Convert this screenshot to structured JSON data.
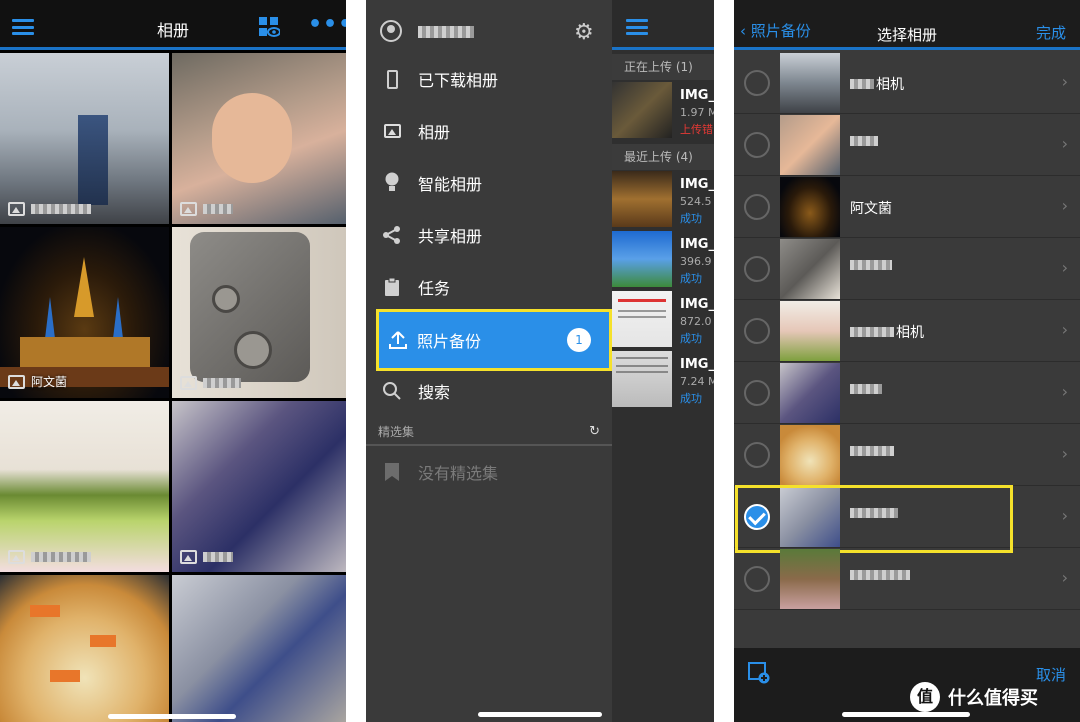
{
  "panel1": {
    "title": "相册",
    "tiles": [
      {
        "label": "",
        "label_visible": true
      },
      {
        "label": "",
        "label_visible": true
      },
      {
        "label": "阿文菌",
        "label_visible": true
      },
      {
        "label": "",
        "label_visible": true
      },
      {
        "label": "",
        "label_visible": true
      },
      {
        "label": "",
        "label_visible": true
      },
      {
        "label": "",
        "label_visible": false
      },
      {
        "label": "",
        "label_visible": false
      }
    ]
  },
  "panel2": {
    "menu": [
      {
        "label": "已下载相册",
        "icon": "phone-icon"
      },
      {
        "label": "相册",
        "icon": "image-icon"
      },
      {
        "label": "智能相册",
        "icon": "bulb-icon"
      },
      {
        "label": "共享相册",
        "icon": "share-icon"
      },
      {
        "label": "任务",
        "icon": "clipboard-icon"
      },
      {
        "label": "照片备份",
        "icon": "upload-icon",
        "badge": "1"
      },
      {
        "label": "搜索",
        "icon": "search-icon"
      }
    ],
    "section_label": "精选集",
    "empty_label": "没有精选集",
    "uploading_label": "正在上传 (1)",
    "recent_label": "最近上传 (4)",
    "uploads": [
      {
        "name": "IMG_",
        "size": "1.97 M",
        "status": "上传错",
        "error": true
      },
      {
        "name": "IMG_",
        "size": "524.5",
        "status": "成功",
        "error": false
      },
      {
        "name": "IMG_",
        "size": "396.9",
        "status": "成功",
        "error": false
      },
      {
        "name": "IMG_",
        "size": "872.0",
        "status": "成功",
        "error": false
      },
      {
        "name": "IMG_",
        "size": "7.24 M",
        "status": "成功",
        "error": false
      }
    ]
  },
  "panel3": {
    "back_label": "照片备份",
    "title": "选择相册",
    "done_label": "完成",
    "cancel_label": "取消",
    "albums": [
      {
        "name": "相机",
        "checked": false
      },
      {
        "name": "",
        "checked": false
      },
      {
        "name": "阿文菌",
        "checked": false
      },
      {
        "name": "",
        "checked": false
      },
      {
        "name": "相机",
        "checked": false
      },
      {
        "name": "",
        "checked": false
      },
      {
        "name": "",
        "checked": false
      },
      {
        "name": "",
        "checked": true
      },
      {
        "name": "",
        "checked": false
      }
    ],
    "watermark": "什么值得买",
    "watermark_glyph": "值"
  },
  "colors": {
    "accent": "#2a8fe8",
    "highlight": "#f5e12b",
    "error": "#e53935"
  }
}
